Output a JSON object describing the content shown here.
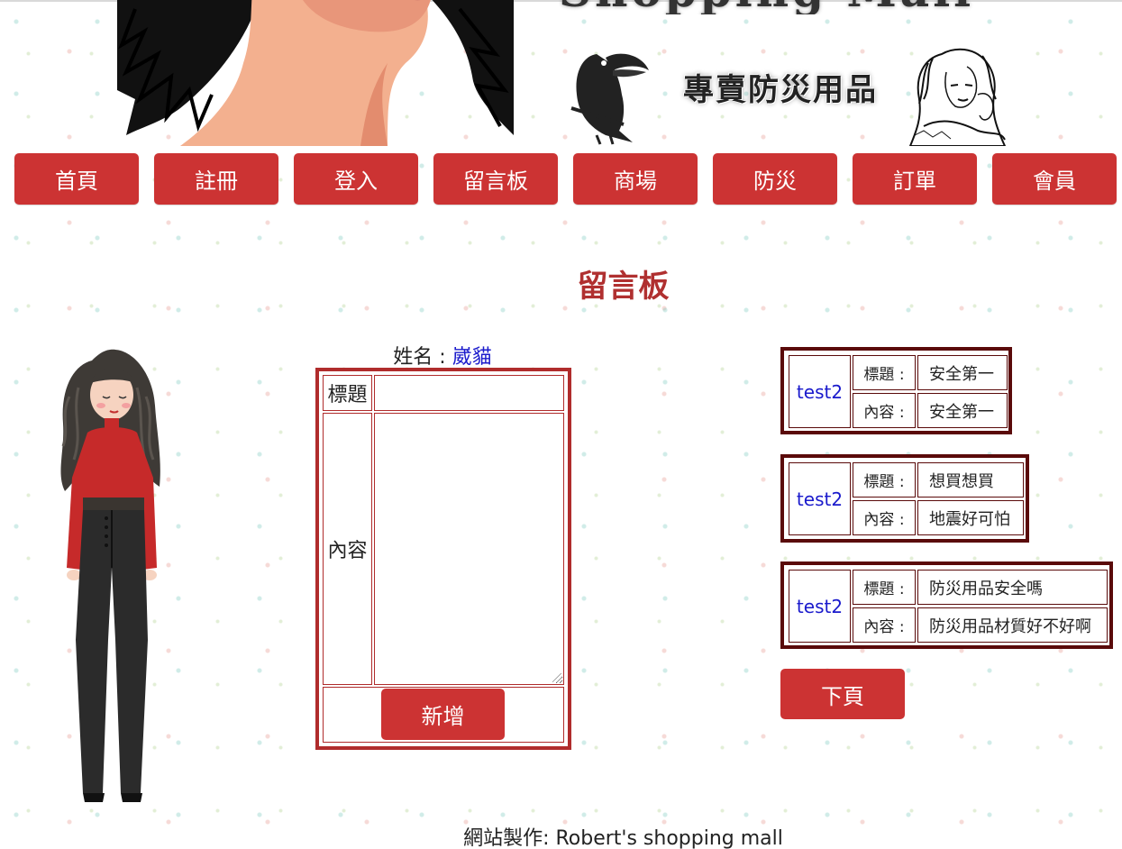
{
  "banner": {
    "title_partial": "Shopping Mall",
    "tagline": "專賣防災用品"
  },
  "nav": {
    "items": [
      {
        "label": "首頁"
      },
      {
        "label": "註冊"
      },
      {
        "label": "登入"
      },
      {
        "label": "留言板"
      },
      {
        "label": "商場"
      },
      {
        "label": "防災"
      },
      {
        "label": "訂單"
      },
      {
        "label": "會員"
      }
    ]
  },
  "page": {
    "heading": "留言板"
  },
  "form": {
    "name_label": "姓名 : ",
    "name_value": "崴貓",
    "title_label": "標題",
    "title_value": "",
    "content_label": "內容",
    "content_value": "",
    "submit_label": "新增"
  },
  "messages": [
    {
      "author": "test2",
      "title_label": "標題 :",
      "title": "安全第一",
      "content_label": "內容 :",
      "content": "安全第一"
    },
    {
      "author": "test2",
      "title_label": "標題 :",
      "title": "想買想買",
      "content_label": "內容 :",
      "content": "地震好可怕"
    },
    {
      "author": "test2",
      "title_label": "標題 :",
      "title": "防災用品安全嗎",
      "content_label": "內容 :",
      "content": "防災用品材質好不好啊"
    }
  ],
  "pagination": {
    "next_label": "下頁"
  },
  "footer": {
    "text": "網站製作: Robert's shopping mall"
  },
  "colors": {
    "button_red": "#cc3333",
    "heading_red": "#b03030",
    "form_border": "#b02c2c",
    "message_border": "#5a0a0a",
    "link_blue": "#1a1acc"
  },
  "icons": {
    "banner_face": "woman-face-illustration",
    "banner_toucan": "toucan-icon",
    "banner_lady": "vintage-lady-sketch",
    "girl": "standing-girl-illustration"
  }
}
